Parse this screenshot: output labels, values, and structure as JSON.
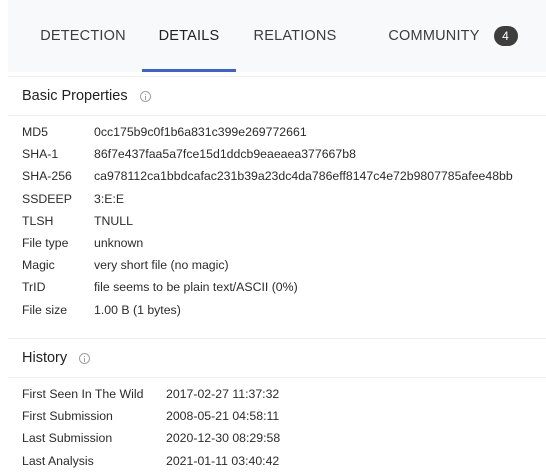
{
  "tabs": [
    {
      "label": "DETECTION"
    },
    {
      "label": "DETAILS"
    },
    {
      "label": "RELATIONS"
    },
    {
      "label": "COMMUNITY",
      "badge": "4"
    }
  ],
  "basic_properties": {
    "title": "Basic Properties",
    "rows": [
      {
        "key": "MD5",
        "value": "0cc175b9c0f1b6a831c399e269772661"
      },
      {
        "key": "SHA-1",
        "value": "86f7e437faa5a7fce15d1ddcb9eaeaea377667b8"
      },
      {
        "key": "SHA-256",
        "value": "ca978112ca1bbdcafac231b39a23dc4da786eff8147c4e72b9807785afee48bb"
      },
      {
        "key": "SSDEEP",
        "value": "3:E:E"
      },
      {
        "key": "TLSH",
        "value": "TNULL"
      },
      {
        "key": "File type",
        "value": "unknown"
      },
      {
        "key": "Magic",
        "value": "very short file (no magic)"
      },
      {
        "key": "TrID",
        "value": "file seems to be plain text/ASCII (0%)"
      },
      {
        "key": "File size",
        "value": "1.00 B (1 bytes)"
      }
    ]
  },
  "history": {
    "title": "History",
    "rows": [
      {
        "key": "First Seen In The Wild",
        "value": "2017-02-27 11:37:32"
      },
      {
        "key": "First Submission",
        "value": "2008-05-21 04:58:11"
      },
      {
        "key": "Last Submission",
        "value": "2020-12-30 08:29:58"
      },
      {
        "key": "Last Analysis",
        "value": "2021-01-11 03:40:42"
      }
    ]
  },
  "colors": {
    "accent": "#3b61d6",
    "tabbar_bg": "#f8f9fa",
    "badge_bg": "#3d3d3d"
  }
}
